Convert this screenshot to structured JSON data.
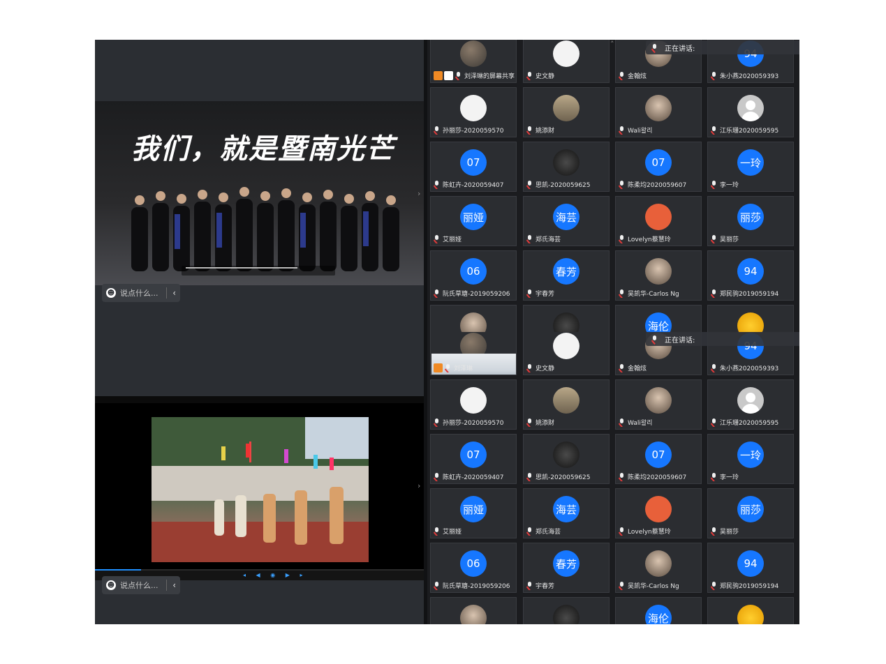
{
  "chat": {
    "placeholder": "说点什么..."
  },
  "speaking": {
    "label": "正在讲话:"
  },
  "top_video": {
    "title": "我们，就是暨南光芒"
  },
  "participants": [
    [
      "刘泽琳的屏幕共享",
      "史文静",
      "金翰炫",
      "朱小燕2020059393"
    ],
    [
      "孙丽莎-2020059570",
      "姚添财",
      "Wali왈리",
      "江乐珊2020059595"
    ],
    [
      "陈虹卉-2020059407",
      "思凯-2020059625",
      "陈柔均2020059607",
      "李一玲"
    ],
    [
      "艾丽娅",
      "郑氏海芸",
      "Lovelyn蔡慧玲",
      "吴丽莎"
    ],
    [
      "阮氏草瑭-2019059206",
      "宇春芳",
      "吴凯华-Carlos Ng",
      "郑民驹2019059194"
    ]
  ],
  "participants_b": [
    [
      "刘泽琳",
      "史文静",
      "金翰炫",
      "朱小燕2020059393"
    ],
    [
      "孙丽莎-2020059570",
      "姚添财",
      "Wali왈리",
      "江乐珊2020059595"
    ],
    [
      "陈虹卉-2020059407",
      "思凯-2020059625",
      "陈柔均2020059607",
      "李一玲"
    ],
    [
      "艾丽娅",
      "郑氏海芸",
      "Lovelyn蔡慧玲",
      "吴丽莎"
    ],
    [
      "阮氏草瑭-2019059206",
      "宇春芳",
      "吴凯华-Carlos Ng",
      "郑民驹2019059194"
    ]
  ],
  "avatar_text": {
    "07a": "07",
    "yiling": "一玲",
    "07b": "07",
    "liya": "丽娅",
    "haiyun": "海芸",
    "lisha": "丽莎",
    "06": "06",
    "chunfang": "春芳",
    "94": "94",
    "hailun": "海伦"
  },
  "icons": {
    "chat": "smile-icon",
    "collapse": "chevron-left-icon",
    "mic": "mic-muted-icon"
  }
}
